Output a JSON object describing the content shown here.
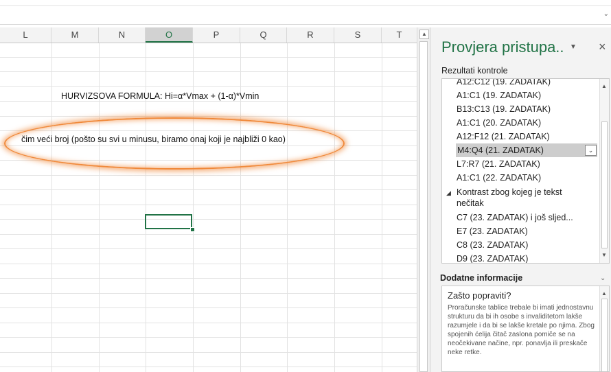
{
  "grid": {
    "columns": [
      "L",
      "M",
      "N",
      "O",
      "P",
      "Q",
      "R",
      "S",
      "T"
    ],
    "selected_column": "O",
    "formula_text": "HURVIZSOVA FORMULA:  Hi=α*Vmax + (1-α)*Vmin",
    "note_text": "čim veći broj (pošto su svi u minusu, biramo onaj koji je najbliži 0 kao)"
  },
  "pane": {
    "title": "Provjera pristupa..",
    "results_label": "Rezultati kontrole",
    "items_before": [
      "A12:C12 (19. ZADATAK)",
      "A1:C1 (19. ZADATAK)",
      "B13:C13 (19. ZADATAK)",
      "A1:C1 (20. ZADATAK)",
      "A12:F12 (21. ZADATAK)"
    ],
    "selected_item": "M4:Q4 (21. ZADATAK)",
    "items_after": [
      "L7:R7 (21. ZADATAK)",
      "A1:C1 (22. ZADATAK)"
    ],
    "group_label": "Kontrast zbog kojeg je tekst nečitak",
    "group_items": [
      "C7 (23. ZADATAK) i još sljed...",
      "E7 (23. ZADATAK)",
      "C8 (23. ZADATAK)",
      "D9 (23. ZADATAK)"
    ],
    "additional_label": "Dodatne informacije",
    "why_title": "Zašto popraviti?",
    "why_text": "Proračunske tablice trebale bi imati jednostavnu strukturu da bi ih osobe s invaliditetom lakše razumjele i da bi se lakše kretale po njima. Zbog spojenih ćelija čitač zaslona pomiče se na neočekivane načine, npr. ponavlja ili preskače neke retke."
  }
}
